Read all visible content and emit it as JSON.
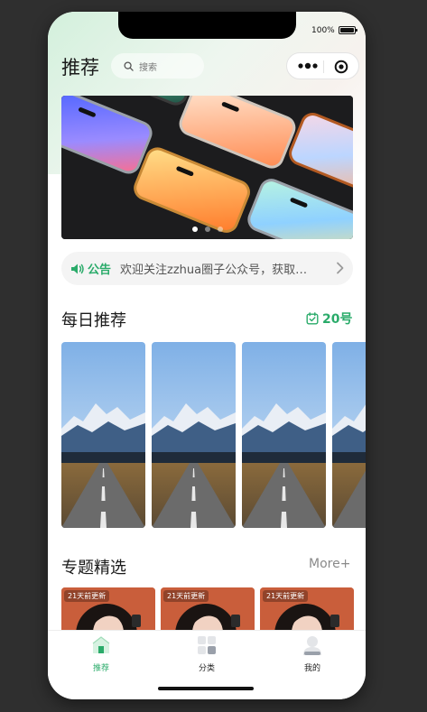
{
  "status_bar": {
    "battery_text": "100%"
  },
  "header": {
    "title": "推荐",
    "search_placeholder": "搜索"
  },
  "capsule": {
    "more_icon": "more-dots-icon",
    "close_icon": "target-icon"
  },
  "banner": {
    "dot_count": 3,
    "active_dot": 0
  },
  "notice": {
    "tag": "公告",
    "message": "欢迎关注zzhua圈子公众号，获取更多精彩内容"
  },
  "daily": {
    "title": "每日推荐",
    "date_label": "20号",
    "card_count": 4
  },
  "topics": {
    "title": "专题精选",
    "more_label": "More+",
    "cards": [
      {
        "badge": "21天前更新"
      },
      {
        "badge": "21天前更新"
      },
      {
        "badge": "21天前更新"
      }
    ]
  },
  "tabbar": {
    "items": [
      {
        "label": "推荐",
        "icon": "home-icon",
        "active": true
      },
      {
        "label": "分类",
        "icon": "grid-icon",
        "active": false
      },
      {
        "label": "我的",
        "icon": "user-icon",
        "active": false
      }
    ]
  },
  "colors": {
    "accent": "#2aab6a"
  }
}
